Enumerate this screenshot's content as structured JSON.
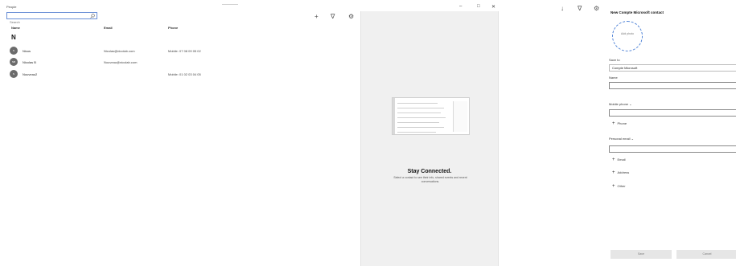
{
  "app": {
    "title": "People"
  },
  "search": {
    "placeholder": "Search"
  },
  "table": {
    "columns": [
      "Name",
      "Email",
      "Phone"
    ],
    "group_letter": "N",
    "rows": [
      {
        "initials": "N",
        "name": "Nicus",
        "email": "Nicolas@nicolab.com",
        "phone": "Mobile: 07 08 09 05 02"
      },
      {
        "initials": "NB",
        "name": "Nicolas B",
        "email": "Nouveau@nicolab.com",
        "phone": ""
      },
      {
        "initials": "N",
        "name": "Nouveau2",
        "email": "",
        "phone": "Mobile: 01 02 03 04 05"
      }
    ]
  },
  "toolbar": {
    "add_glyph": "+",
    "filter_glyph": "∇",
    "settings_glyph": "⚙"
  },
  "center": {
    "title": "Stay Connected.",
    "description": "Select a contact to see their info, shared events and recent conversations."
  },
  "window_controls": {
    "minimize": "–",
    "maximize": "□",
    "close": "✕"
  },
  "right_toolbar": {
    "pin_glyph": "↓",
    "filter_glyph": "∇",
    "settings_glyph": "⚙"
  },
  "new_contact": {
    "title": "New Compte Microsoft contact",
    "photo_label": "Add photo",
    "save_to_label": "Save to",
    "save_to_value": "Compte Microsoft",
    "name_label": "Name",
    "name_value": "",
    "mobile_label": "Mobile phone",
    "add_phone": "Phone",
    "personal_email_label": "Personal email",
    "add_email": "Email",
    "add_address": "Address",
    "add_other": "Other",
    "save_button": "Save",
    "cancel_button": "Cancel"
  },
  "colors": {
    "accent": "#4a7fd6",
    "avatar": "#6b6b6b",
    "pane_bg": "#f0f0f0"
  }
}
